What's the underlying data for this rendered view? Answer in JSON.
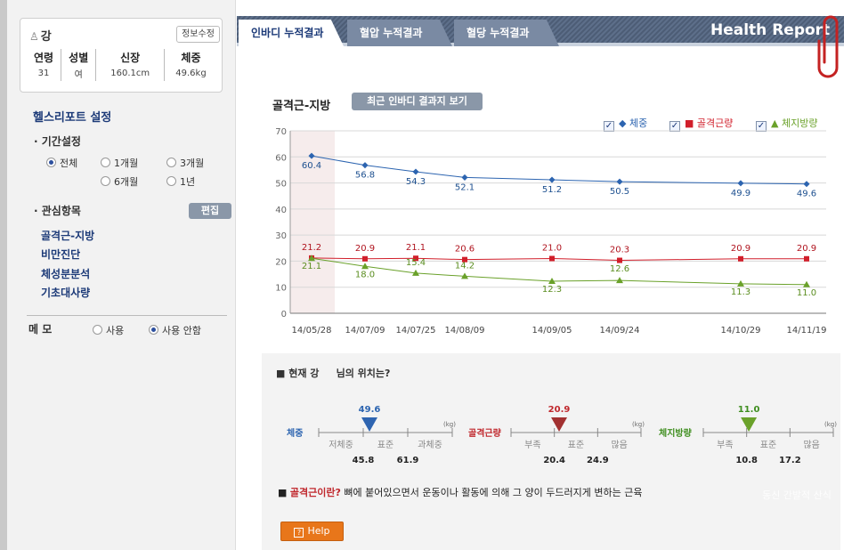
{
  "profile": {
    "name": "강",
    "edit_info_label": "정보수정",
    "headers": [
      "연령",
      "성별",
      "신장",
      "체중"
    ],
    "values": [
      "31",
      "여",
      "160.1cm",
      "49.6kg"
    ]
  },
  "sidebar": {
    "settings_title": "헬스리포트 설정",
    "period_label": "기간설정",
    "period_options": [
      {
        "label": "전체",
        "selected": true
      },
      {
        "label": "1개월",
        "selected": false
      },
      {
        "label": "3개월",
        "selected": false
      },
      {
        "label": "6개월",
        "selected": false
      },
      {
        "label": "1년",
        "selected": false
      }
    ],
    "interest_label": "관심항목",
    "edit_label": "편집",
    "interest_items": [
      "골격근-지방",
      "비만진단",
      "체성분분석",
      "기초대사량"
    ],
    "memo_label": "메 모",
    "memo_options": [
      {
        "label": "사용",
        "selected": false
      },
      {
        "label": "사용 안함",
        "selected": true
      }
    ]
  },
  "tabs": [
    {
      "label": "인바디 누적결과",
      "active": true
    },
    {
      "label": "혈압 누적결과",
      "active": false
    },
    {
      "label": "혈당 누적결과",
      "active": false
    }
  ],
  "brand": "Health Report",
  "chart_section": {
    "title": "골격근-지방",
    "recent_button": "최근 인바디 결과지 보기",
    "legend": [
      {
        "label": "체중",
        "marker": "◆",
        "color": "#2c64b0"
      },
      {
        "label": "골격근량",
        "marker": "■",
        "color": "#d11f2b"
      },
      {
        "label": "체지방량",
        "marker": "▲",
        "color": "#6aa12a"
      }
    ]
  },
  "chart_data": {
    "type": "line",
    "categories": [
      "14/05/28",
      "14/07/09",
      "14/07/25",
      "14/08/09",
      "14/09/05",
      "14/09/24",
      "14/10/29",
      "14/11/19"
    ],
    "ylim": [
      0,
      70
    ],
    "yticks": [
      0,
      10,
      20,
      30,
      40,
      50,
      60,
      70
    ],
    "grid": true,
    "legend_position": "top-right",
    "series": [
      {
        "name": "체중",
        "color": "#2c64b0",
        "marker": "diamond",
        "values": [
          60.4,
          56.8,
          54.3,
          52.1,
          51.2,
          50.5,
          49.9,
          49.6
        ]
      },
      {
        "name": "골격근량",
        "color": "#d11f2b",
        "marker": "square",
        "values": [
          21.2,
          20.9,
          21.1,
          20.6,
          21.0,
          20.3,
          20.9,
          20.9
        ]
      },
      {
        "name": "체지방량",
        "color": "#6aa12a",
        "marker": "triangle",
        "values": [
          21.1,
          18.0,
          15.4,
          14.2,
          12.3,
          12.6,
          11.3,
          11.0
        ]
      }
    ]
  },
  "position": {
    "title_prefix": "■ 현재 강",
    "title_suffix": "님의 위치는?",
    "gauges": [
      {
        "name": "체중",
        "value": "49.6",
        "unit": "(kg)",
        "zones": [
          "저체중",
          "표준",
          "과체중"
        ],
        "bounds": [
          "45.8",
          "61.9"
        ],
        "color": "#2c64b0",
        "marker": "#2e64b0",
        "level": 0.38
      },
      {
        "name": "골격근량",
        "value": "20.9",
        "unit": "(kg)",
        "zones": [
          "부족",
          "표준",
          "많음"
        ],
        "bounds": [
          "20.4",
          "24.9"
        ],
        "color": "#c0282d",
        "marker": "#a23131",
        "level": 0.37
      },
      {
        "name": "체지방량",
        "value": "11.0",
        "unit": "(kg)",
        "zones": [
          "부족",
          "표준",
          "많음"
        ],
        "bounds": [
          "10.8",
          "17.2"
        ],
        "color": "#3f8e1f",
        "marker": "#6aa12a",
        "level": 0.35
      }
    ],
    "definition_bold": "골격근이란?",
    "definition_text": " 뼈에 붙어있으면서 운동이나 활동에 의해 그 양이 두드러지게 변하는 근육",
    "ghost_button": "동신 간발적 산식",
    "help_label": "Help"
  }
}
